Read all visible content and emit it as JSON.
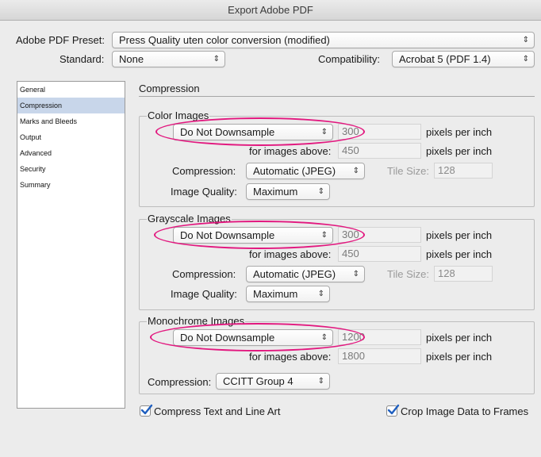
{
  "window": {
    "title": "Export Adobe PDF"
  },
  "top": {
    "preset_label": "Adobe PDF Preset:",
    "preset_value": "Press Quality uten color conversion (modified)",
    "standard_label": "Standard:",
    "standard_value": "None",
    "compat_label": "Compatibility:",
    "compat_value": "Acrobat 5 (PDF 1.4)"
  },
  "sidebar": {
    "items": [
      {
        "label": "General"
      },
      {
        "label": "Compression"
      },
      {
        "label": "Marks and Bleeds"
      },
      {
        "label": "Output"
      },
      {
        "label": "Advanced"
      },
      {
        "label": "Security"
      },
      {
        "label": "Summary"
      }
    ]
  },
  "section_title": "Compression",
  "color": {
    "title": "Color Images",
    "downsample": "Do Not Downsample",
    "ppi_value": "300",
    "ppi_unit": "pixels per inch",
    "above_label": "for images above:",
    "above_value": "450",
    "above_unit": "pixels per inch",
    "compression_label": "Compression:",
    "compression_value": "Automatic (JPEG)",
    "tile_label": "Tile Size:",
    "tile_value": "128",
    "quality_label": "Image Quality:",
    "quality_value": "Maximum"
  },
  "gray": {
    "title": "Grayscale Images",
    "downsample": "Do Not Downsample",
    "ppi_value": "300",
    "ppi_unit": "pixels per inch",
    "above_label": "for images above:",
    "above_value": "450",
    "above_unit": "pixels per inch",
    "compression_label": "Compression:",
    "compression_value": "Automatic (JPEG)",
    "tile_label": "Tile Size:",
    "tile_value": "128",
    "quality_label": "Image Quality:",
    "quality_value": "Maximum"
  },
  "mono": {
    "title": "Monochrome Images",
    "downsample": "Do Not Downsample",
    "ppi_value": "1200",
    "ppi_unit": "pixels per inch",
    "above_label": "for images above:",
    "above_value": "1800",
    "above_unit": "pixels per inch",
    "compression_label": "Compression:",
    "compression_value": "CCITT Group 4"
  },
  "options": {
    "compress_text": "Compress Text and Line Art",
    "crop_image": "Crop Image Data to Frames"
  },
  "colors": {
    "highlight": "#e2187f",
    "selected_row": "#c8d6ea",
    "check": "#1f5fbf"
  }
}
